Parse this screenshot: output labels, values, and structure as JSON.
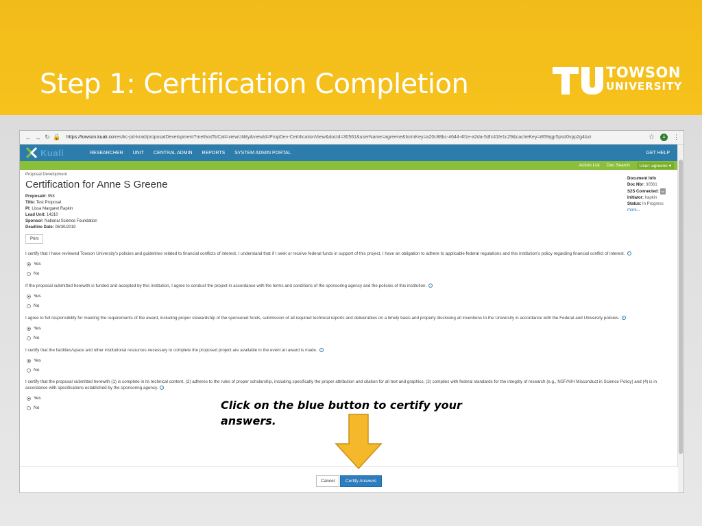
{
  "slide": {
    "title": "Step 1: Certification Completion",
    "logo_line1": "TOWSON",
    "logo_line2": "UNIVERSITY",
    "callout_line1": "Click on the blue button to certify your",
    "callout_line2": "answers.",
    "accent_color": "#f7c21c"
  },
  "browser": {
    "url_host": "https://towson.kuali.co",
    "url_path": "/res/kc-pd-krad/proposalDevelopment?methodToCall=viewUtility&viewId=PropDev-CertificationView&docId=30561&userName=agreene&formKey=a20c88bc-4644-4f1e-a2da-5dfc41fe1c29&cacheKey=i859qgr5psd0vpp2g4bzr",
    "avatar_letter": "A"
  },
  "topnav": {
    "logo_word": "Kuali",
    "items": [
      "RESEARCHER",
      "UNIT",
      "CENTRAL ADMIN",
      "REPORTS",
      "SYSTEM ADMIN PORTAL"
    ],
    "help": "GET HELP"
  },
  "subnav": {
    "action_list": "Action List",
    "doc_search": "Doc Search",
    "user": "User: agreene ▾"
  },
  "page": {
    "breadcrumb": "Proposal Development",
    "title": "Certification for Anne S Greene",
    "proposal_label": "Proposal#:",
    "proposal_value": "958",
    "title_label": "Title:",
    "title_value": "Test Proposal",
    "pi_label": "PI:",
    "pi_value": "Lissa Margaret Rapkin",
    "lead_unit_label": "Lead Unit:",
    "lead_unit_value": "14210",
    "sponsor_label": "Sponsor:",
    "sponsor_value": "National Science Foundation",
    "deadline_label": "Deadline Date:",
    "deadline_value": "06/30/2019",
    "print_label": "Print"
  },
  "docinfo": {
    "heading": "Document Info",
    "doc_nbr_label": "Doc Nbr:",
    "doc_nbr_value": "30561",
    "s2s_label": "S2S Connected:",
    "s2s_badge": "no",
    "initiator_label": "Initiator:",
    "initiator_value": "lrapkin",
    "status_label": "Status:",
    "status_value": "In Progress",
    "more": "more..."
  },
  "questions": [
    {
      "text": "I certify that I have reviewed Towson University's policies and guidelines related to financial conflicts of interest. I understand that if I seek or receive federal funds in support of this project, I have an obligation to adhere to applicable federal regulations and this institution's policy regarding financial conflict of interest.",
      "yes": "Yes",
      "no": "No"
    },
    {
      "text": "If the proposal submitted herewith is funded and accepted by this institution, I agree to conduct the project in accordance with the terms and conditions of the sponsoring agency and the policies of this institution.",
      "yes": "Yes",
      "no": "No"
    },
    {
      "text": "I agree to full responsibility for meeting the requirements of the award, including proper stewardship of the sponsored funds, submission of all required technical reports and deliverables on a timely basis and properly disclosing all inventions to the University in accordance with the Federal and University policies.",
      "yes": "Yes",
      "no": "No"
    },
    {
      "text": "I certify that the facilities/space and other institutional resources necessary to complete the proposed project are available in the event an award is made.",
      "yes": "Yes",
      "no": "No"
    },
    {
      "text": "I certify that the proposal submitted herewith (1) is complete in its technical content, (2) adheres to the rules of proper scholarship, including specifically the proper attribution and citation for all text and graphics, (3) complies with federal standards for the integrity of research (e.g., NSF/NIH Misconduct in Science Policy) and (4) is in accordance with specifications established by the sponsoring agency.",
      "yes": "Yes",
      "no": "No"
    }
  ],
  "footer": {
    "cancel_label": "Cancel",
    "certify_label": "Certify Answers"
  }
}
